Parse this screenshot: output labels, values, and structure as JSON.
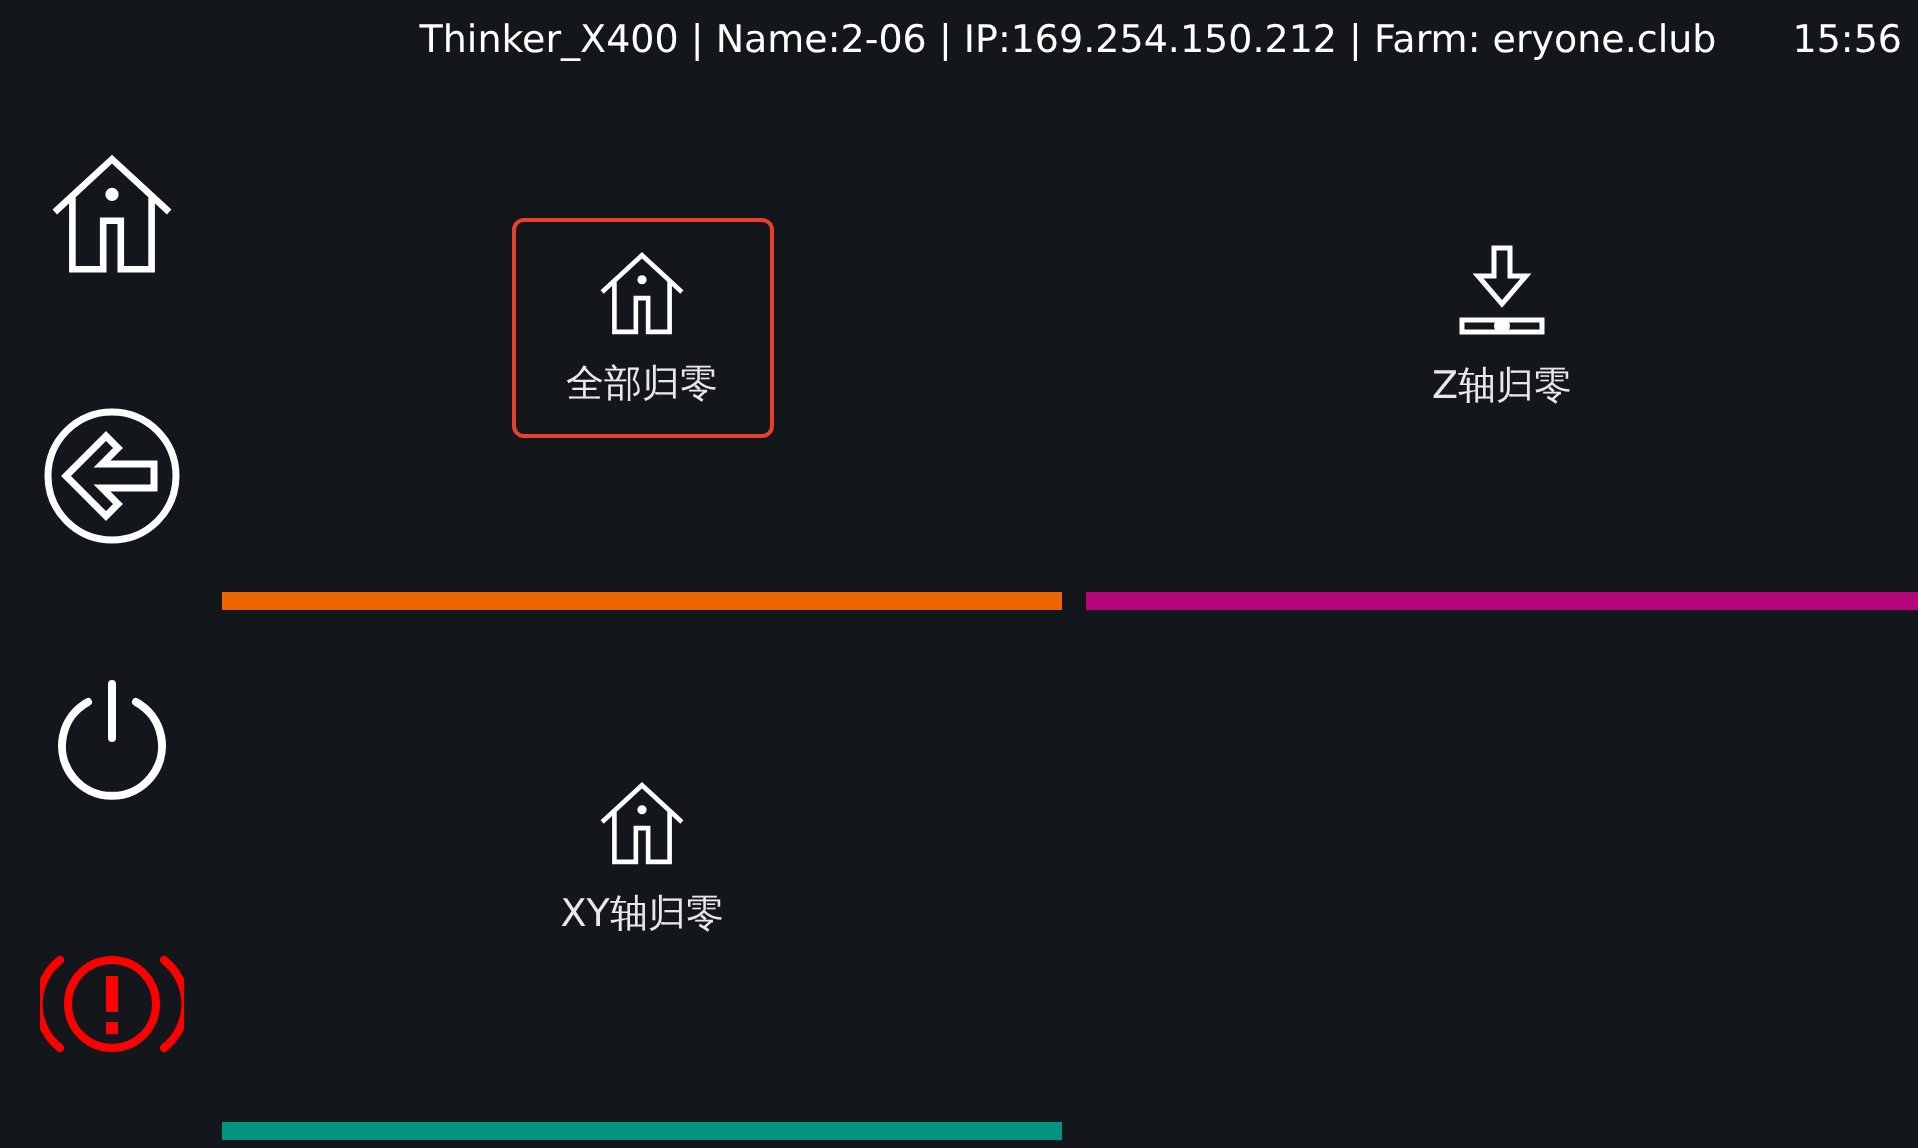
{
  "status_bar": {
    "info": "Thinker_X400 | Name:2-06 | IP:169.254.150.212 | Farm: eryone.club",
    "time": "15:56"
  },
  "sidebar": {
    "items": [
      {
        "kind": "home"
      },
      {
        "kind": "back"
      },
      {
        "kind": "power"
      },
      {
        "kind": "alert"
      }
    ]
  },
  "tiles": [
    {
      "label": "全部归零",
      "kind": "home",
      "color": "#ee6600",
      "selected": true
    },
    {
      "label": "Z轴归零",
      "kind": "z_home",
      "color": "#b4047a",
      "selected": false
    },
    {
      "label": "XY轴归零",
      "kind": "home",
      "color": "#009480",
      "selected": false
    }
  ]
}
